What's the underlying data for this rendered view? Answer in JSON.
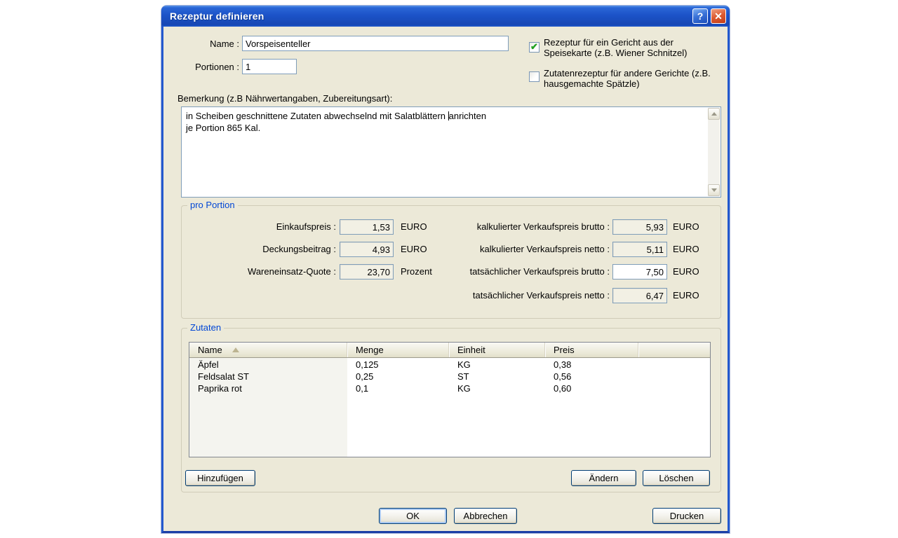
{
  "dialog": {
    "title": "Rezeptur definieren"
  },
  "icons": {
    "help": "?",
    "close": "✕",
    "check": "✔"
  },
  "form": {
    "name_label": "Name :",
    "name_value": "Vorspeisenteller",
    "portions_label": "Portionen :",
    "portions_value": "1",
    "checkbox1": {
      "checked": true,
      "line1": "Rezeptur für ein Gericht aus der",
      "line2": "Speisekarte (z.B. Wiener Schnitzel)"
    },
    "checkbox2": {
      "checked": false,
      "line1": "Zutatenrezeptur für andere Gerichte (z.B.",
      "line2": "hausgemachte Spätzle)"
    },
    "remark_label": "Bemerkung (z.B Nährwertangaben, Zubereitungsart):",
    "remark_line1_before_caret": "in Scheiben geschnittene Zutaten abwechselnd mit Salatblättern ",
    "remark_line1_after_caret": "anrichten",
    "remark_line2": "je Portion 865 Kal."
  },
  "pro_portion": {
    "title": "pro Portion",
    "fields_left": [
      {
        "label": "Einkaufspreis :",
        "value": "1,53",
        "unit": "EURO"
      },
      {
        "label": "Deckungsbeitrag :",
        "value": "4,93",
        "unit": "EURO"
      },
      {
        "label": "Wareneinsatz-Quote :",
        "value": "23,70",
        "unit": "Prozent"
      }
    ],
    "fields_right": [
      {
        "label": "kalkulierter Verkaufspreis brutto :",
        "value": "5,93",
        "unit": "EURO"
      },
      {
        "label": "kalkulierter Verkaufspreis netto :",
        "value": "5,11",
        "unit": "EURO"
      },
      {
        "label": "tatsächlicher Verkaufspreis brutto :",
        "value": "7,50",
        "unit": "EURO"
      },
      {
        "label": "tatsächlicher Verkaufspreis netto :",
        "value": "6,47",
        "unit": "EURO"
      }
    ]
  },
  "zutaten": {
    "title": "Zutaten",
    "columns": [
      "Name",
      "Menge",
      "Einheit",
      "Preis"
    ],
    "rows": [
      {
        "name": "Äpfel",
        "menge": "0,125",
        "einheit": "KG",
        "preis": "0,38"
      },
      {
        "name": "Feldsalat ST",
        "menge": "0,25",
        "einheit": "ST",
        "preis": "0,56"
      },
      {
        "name": "Paprika rot",
        "menge": "0,1",
        "einheit": "KG",
        "preis": "0,60"
      }
    ],
    "add_label": "Hinzufügen",
    "edit_label": "Ändern",
    "delete_label": "Löschen"
  },
  "footer": {
    "ok": "OK",
    "cancel": "Abbrechen",
    "print": "Drucken"
  }
}
